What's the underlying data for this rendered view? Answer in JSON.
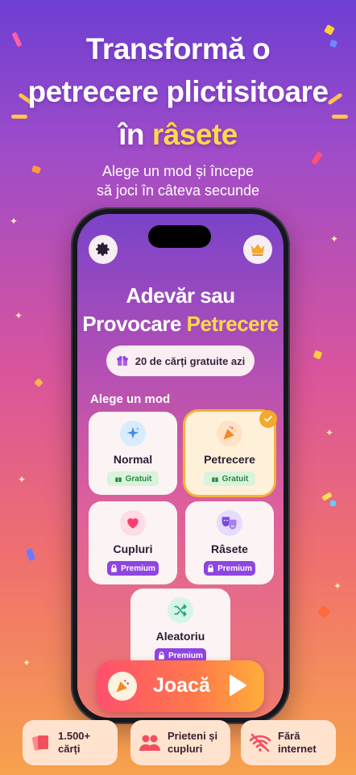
{
  "headline": {
    "line1": "Transformă o",
    "line2": "petrecere plictisitoare",
    "line3_prefix": "în ",
    "line3_accent": "râsete"
  },
  "subline": {
    "line1": "Alege un mod și începe",
    "line2": "să joci în câteva secunde"
  },
  "app": {
    "title_line1": "Adevăr sau",
    "title_line2_prefix": "Provocare ",
    "title_line2_accent": "Petrecere",
    "free_cards_pill": "20 de cărți gratuite azi",
    "section_label": "Alege un mod",
    "modes": [
      {
        "name": "Normal",
        "badge": "Gratuit",
        "tier": "free",
        "icon": "sparkle-icon",
        "selected": false
      },
      {
        "name": "Petrecere",
        "badge": "Gratuit",
        "tier": "free",
        "icon": "party-popper-icon",
        "selected": true
      },
      {
        "name": "Cupluri",
        "badge": "Premium",
        "tier": "premium",
        "icon": "heart-icon",
        "selected": false
      },
      {
        "name": "Râsete",
        "badge": "Premium",
        "tier": "premium",
        "icon": "theater-masks-icon",
        "selected": false
      },
      {
        "name": "Aleatoriu",
        "badge": "Premium",
        "tier": "premium",
        "icon": "shuffle-icon",
        "selected": false
      }
    ],
    "play_label": "Joacă"
  },
  "features": [
    {
      "line1": "1.500+",
      "line2": "cărți",
      "icon": "cards-icon"
    },
    {
      "line1": "Prieteni și",
      "line2": "cupluri",
      "icon": "people-icon"
    },
    {
      "line1": "Fără",
      "line2": "internet",
      "icon": "wifi-off-icon"
    }
  ],
  "colors": {
    "accent_yellow": "#ffd84a",
    "free_badge": "#2f8a40",
    "premium_badge": "#8e45e2",
    "selected_border": "#f4b23a"
  }
}
